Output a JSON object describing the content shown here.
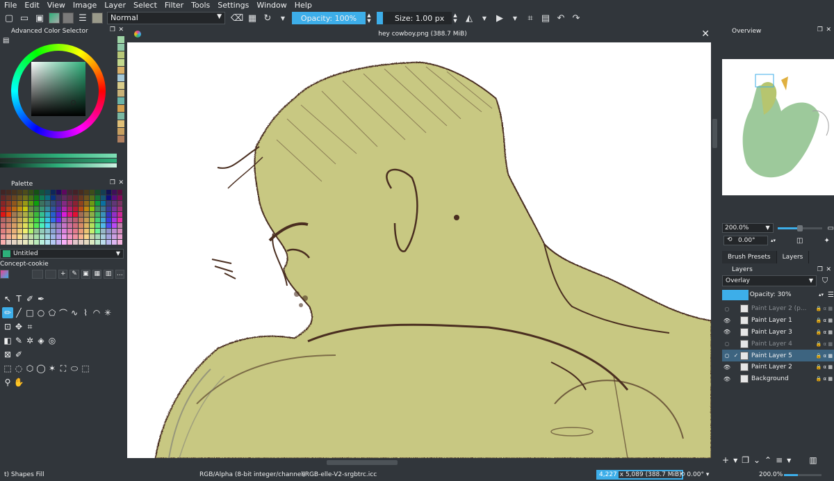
{
  "menu": [
    "File",
    "Edit",
    "View",
    "Image",
    "Layer",
    "Select",
    "Filter",
    "Tools",
    "Settings",
    "Window",
    "Help"
  ],
  "toolbar": {
    "blend_mode": "Normal",
    "opacity": "Opacity: 100%",
    "size": "Size: 1.00 px"
  },
  "color_selector": {
    "title": "Advanced Color Selector",
    "current_color": "#2db07a"
  },
  "palette": {
    "title": "Palette",
    "selected": "Untitled",
    "set_name": "Concept-cookie"
  },
  "document": {
    "title": "hey cowboy.png (388.7 MiB)"
  },
  "overview": {
    "title": "Overview",
    "zoom": "200.0%",
    "rotation": "0.00°"
  },
  "right_tabs": [
    "Brush Presets",
    "Layers"
  ],
  "layers_panel": {
    "title": "Layers",
    "blend_mode": "Overlay",
    "opacity": "Opacity:  30%",
    "layers": [
      {
        "name": "Paint Layer 2 (p...",
        "visible": false,
        "selected": false,
        "dim": true
      },
      {
        "name": "Paint Layer 1",
        "visible": true,
        "selected": false,
        "dim": false
      },
      {
        "name": "Paint Layer 3",
        "visible": true,
        "selected": false,
        "dim": false
      },
      {
        "name": "Paint Layer 4",
        "visible": false,
        "selected": false,
        "dim": true
      },
      {
        "name": "Paint Layer 5",
        "visible": false,
        "selected": true,
        "dim": false
      },
      {
        "name": "Paint Layer 2",
        "visible": true,
        "selected": false,
        "dim": false
      },
      {
        "name": "Background",
        "visible": true,
        "selected": false,
        "dim": false
      }
    ]
  },
  "status": {
    "tool": "t) Shapes Fill",
    "color_model": "RGB/Alpha (8-bit integer/channel)",
    "profile": "sRGB-elle-V2-srgbtrc.icc",
    "size_highlight": "4,227",
    "size_rest": "x 5,089 (388.7 MiB)",
    "rotation": "0.00°",
    "zoom": "200.0%"
  },
  "colors": {
    "accent": "#3daee9",
    "panel": "#31363b",
    "skin": "#c8c882",
    "sketch": "#4a2e20"
  }
}
